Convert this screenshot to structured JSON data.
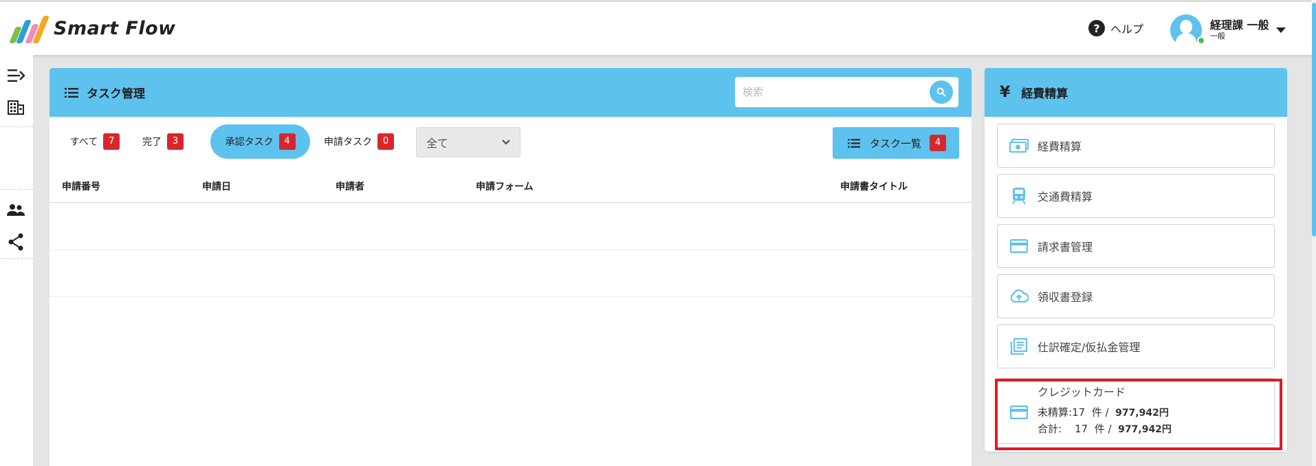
{
  "header": {
    "logo_text": "Smart Flow",
    "help_label": "ヘルプ",
    "user_name": "経理課 一般",
    "user_role": "一般"
  },
  "sidebar": {
    "icons": [
      "collapse-menu-icon",
      "building-icon",
      "users-icon",
      "share-icon"
    ]
  },
  "task_panel": {
    "title": "タスク管理",
    "search_placeholder": "検索",
    "tabs": [
      {
        "label": "すべて",
        "count": "7"
      },
      {
        "label": "完了",
        "count": "3"
      },
      {
        "label": "承認タスク",
        "count": "4"
      },
      {
        "label": "申請タスク",
        "count": "0"
      }
    ],
    "active_tab": "承認タスク",
    "filter_selected": "全て",
    "task_list_label": "タスク一覧",
    "task_list_count": "4",
    "columns": [
      "申請番号",
      "申請日",
      "申請者",
      "申請フォーム",
      "申請書タイトル"
    ]
  },
  "expense_panel": {
    "title": "経費精算",
    "items": [
      {
        "label": "経費精算",
        "icon": "money-icon"
      },
      {
        "label": "交通費精算",
        "icon": "train-icon"
      },
      {
        "label": "請求書管理",
        "icon": "card-icon"
      },
      {
        "label": "領収書登録",
        "icon": "cloud-upload-icon"
      },
      {
        "label": "仕訳確定/仮払金管理",
        "icon": "journal-icon"
      }
    ],
    "credit": {
      "title": "クレジットカード",
      "unsettled_label": "未精算:",
      "unsettled_count": "17",
      "unsettled_amount": "977,942円",
      "total_label": "合計:",
      "total_count": "17",
      "total_amount": "977,942円",
      "unit": "件 /"
    }
  },
  "colors": {
    "accent": "#5ec2ef",
    "badge": "#d9262c",
    "highlight": "#e01a22"
  }
}
